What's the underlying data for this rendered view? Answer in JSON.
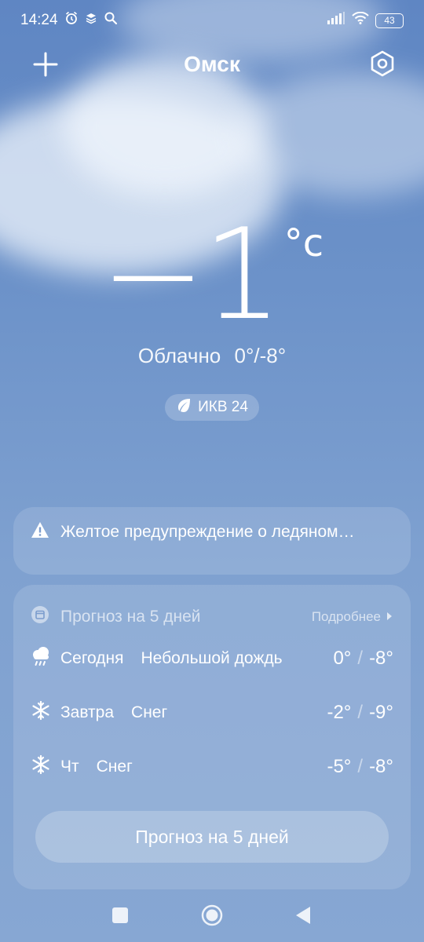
{
  "status_bar": {
    "time": "14:24",
    "battery": "43",
    "icons": [
      "alarm-icon",
      "stack-icon",
      "search-icon",
      "signal-icon",
      "wifi-icon",
      "battery-icon"
    ]
  },
  "header": {
    "city": "Омск",
    "icons": [
      "plus-icon",
      "settings-hex-icon"
    ]
  },
  "current": {
    "temperature": "−1",
    "unit": "°c",
    "condition": "Облачно",
    "range": "0°/-8°"
  },
  "aqi": {
    "label": "ИКВ 24",
    "icon": "leaf-icon"
  },
  "alert": {
    "text": "Желтое предупреждение о ледяном…",
    "icon": "warning-icon"
  },
  "forecast": {
    "title": "Прогноз на 5 дней",
    "more_label": "Подробнее",
    "button_label": "Прогноз на 5 дней",
    "days": [
      {
        "day": "Сегодня",
        "condition": "Небольшой дождь",
        "high": "0°",
        "low": "-8°",
        "icon": "cloud-rain-icon"
      },
      {
        "day": "Завтра",
        "condition": "Снег",
        "high": "-2°",
        "low": "-9°",
        "icon": "snowflake-icon"
      },
      {
        "day": "Чт",
        "condition": "Снег",
        "high": "-5°",
        "low": "-8°",
        "icon": "snowflake-icon"
      }
    ]
  },
  "colors": {
    "background_top": "#5f86c3",
    "background_bottom": "#87a7d3",
    "text": "#ffffff"
  }
}
